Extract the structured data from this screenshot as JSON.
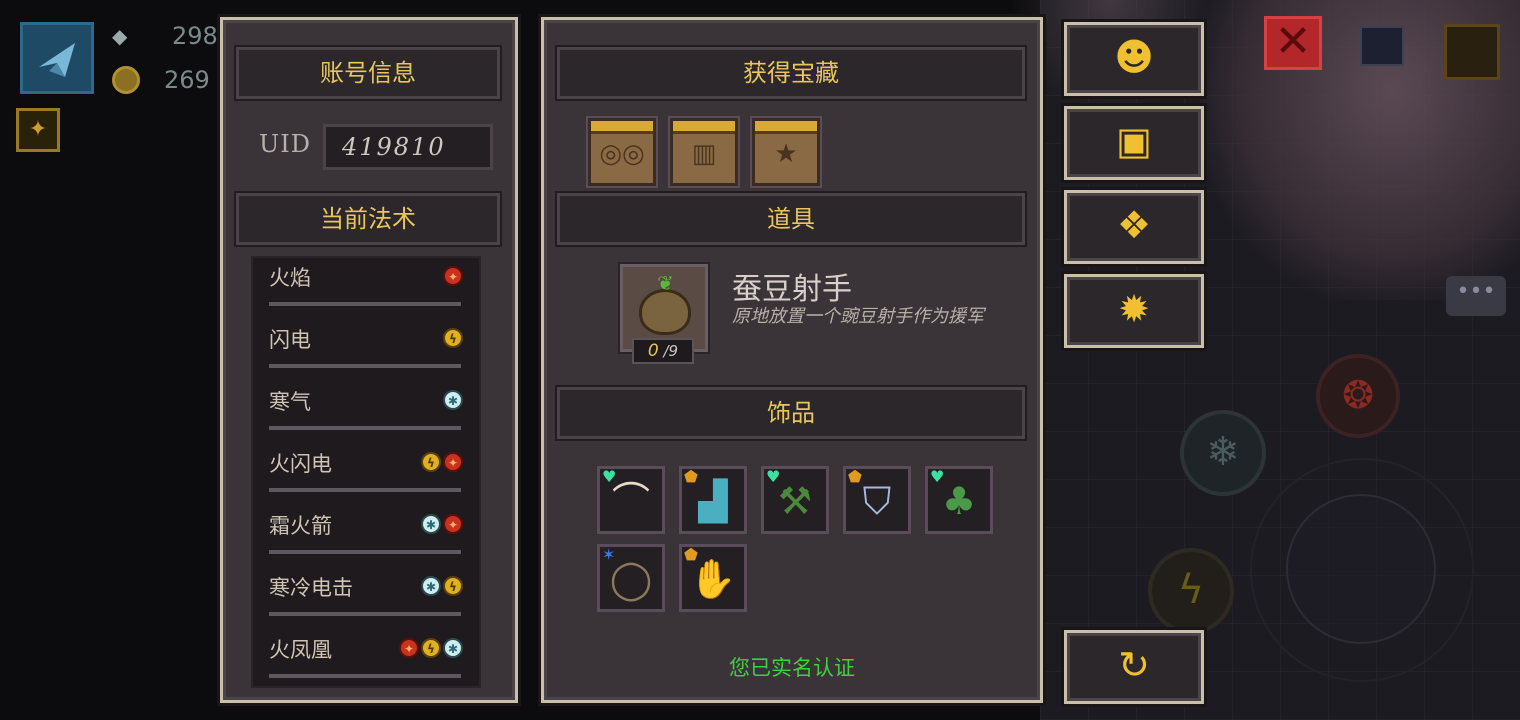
{
  "hud": {
    "gem_value": "298",
    "coin_value": "269"
  },
  "account_panel": {
    "title": "账号信息",
    "uid_label": "UID",
    "uid_value": "419810",
    "spells_title": "当前法术",
    "spells": [
      {
        "name": "火焰",
        "elements": [
          "fire"
        ]
      },
      {
        "name": "闪电",
        "elements": [
          "bolt"
        ]
      },
      {
        "name": "寒气",
        "elements": [
          "ice"
        ]
      },
      {
        "name": "火闪电",
        "elements": [
          "bolt",
          "fire"
        ]
      },
      {
        "name": "霜火箭",
        "elements": [
          "ice",
          "fire"
        ]
      },
      {
        "name": "寒冷电击",
        "elements": [
          "ice",
          "bolt"
        ]
      },
      {
        "name": "火凤凰",
        "elements": [
          "fire",
          "bolt",
          "ice"
        ]
      }
    ]
  },
  "treasure_panel": {
    "title": "获得宝藏",
    "chests": [
      {
        "icon": "glasses-icon"
      },
      {
        "icon": "cape-icon"
      },
      {
        "icon": "star-icon"
      }
    ],
    "items_title": "道具",
    "item": {
      "name": "蚕豆射手",
      "description": "原地放置一个豌豆射手作为援军",
      "count_current": "0",
      "count_max": "/9"
    },
    "accessories_title": "饰品",
    "accessories": [
      {
        "icon": "bone-claw-icon",
        "tag": "heart"
      },
      {
        "icon": "boot-icon",
        "tag": "shield"
      },
      {
        "icon": "shovel-icon",
        "tag": "heart"
      },
      {
        "icon": "armor-icon",
        "tag": "shield"
      },
      {
        "icon": "vine-icon",
        "tag": "heart"
      },
      {
        "icon": "necklace-icon",
        "tag": "star"
      },
      {
        "icon": "glove-icon",
        "tag": "shield"
      }
    ],
    "verified_text": "您已实名认证"
  },
  "side_buttons": [
    {
      "name": "support-button",
      "icon": "headset-icon"
    },
    {
      "name": "gift-button",
      "icon": "gift-icon"
    },
    {
      "name": "code-button",
      "icon": "badge-icon"
    },
    {
      "name": "settings-button",
      "icon": "gear-icon"
    },
    {
      "name": "refresh-button",
      "icon": "refresh-icon"
    }
  ],
  "colors": {
    "accent_gold": "#e8c65a",
    "verified_green": "#3ed03e",
    "close_red": "#b3262a"
  }
}
